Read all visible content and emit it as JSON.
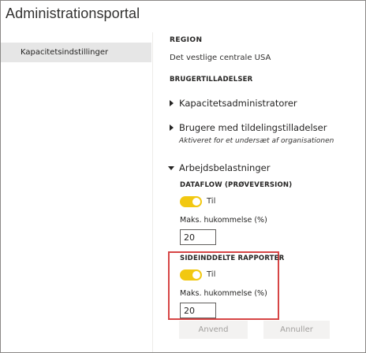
{
  "app": {
    "title": "Administrationsportal"
  },
  "sidebar": {
    "items": [
      {
        "label": "Kapacitetsindstillinger"
      }
    ]
  },
  "main": {
    "region_label": "REGION",
    "region_value": "Det vestlige centrale USA",
    "permissions_heading": "BRUGERTILLADELSER",
    "capacity_admins_label": "Kapacitetsadministratorer",
    "assignment_users_label": "Brugere med tildelingstilladelser",
    "assignment_users_note": "Aktiveret for et undersæt af organisationen",
    "workloads_label": "Arbejdsbelastninger",
    "dataflow": {
      "heading": "DATAFLOW (PRØVEVERSION)",
      "toggle_label": "Til",
      "toggle_on": true,
      "memory_label": "Maks. hukommelse (%)",
      "memory_value": "20"
    },
    "paginated": {
      "heading": "SIDEINDDELTE RAPPORTER",
      "toggle_label": "Til",
      "toggle_on": true,
      "memory_label": "Maks. hukommelse (%)",
      "memory_value": "20"
    },
    "apply_label": "Anvend",
    "cancel_label": "Annuller"
  },
  "colors": {
    "toggle_on": "#f2c811",
    "highlight": "#d64545"
  }
}
